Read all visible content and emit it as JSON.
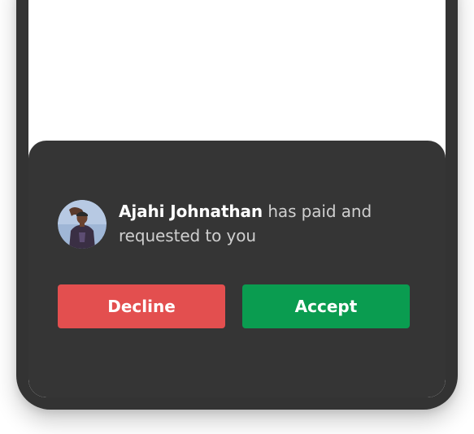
{
  "request": {
    "sender_name": "Ajahi Johnathan",
    "message": "has paid and requested to you",
    "avatar_icon": "user-avatar-photo"
  },
  "actions": {
    "decline_label": "Decline",
    "accept_label": "Accept"
  },
  "colors": {
    "sheet_background": "#353535",
    "frame": "#333333",
    "decline": "#e34f4f",
    "accept": "#0a9c50",
    "name_text": "#ffffff",
    "message_text": "#cfcfcf"
  }
}
